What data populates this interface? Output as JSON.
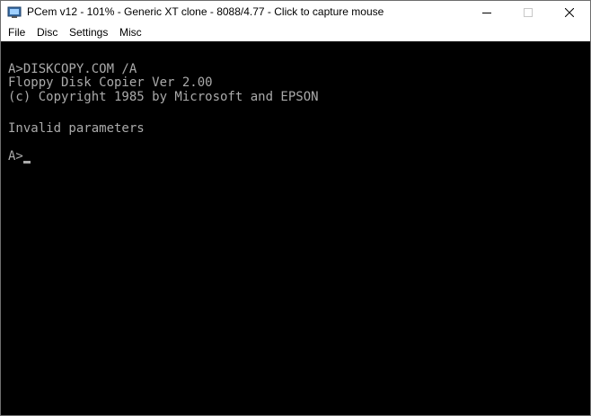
{
  "window": {
    "title": "PCem v12 - 101% - Generic XT clone - 8088/4.77 - Click to capture mouse",
    "icons": {
      "app": "pcem-app-icon",
      "minimize": "minimize-icon",
      "maximize": "maximize-icon",
      "close": "close-icon"
    },
    "colors": {
      "titlebar_bg": "#ffffff",
      "screen_bg": "#000000",
      "screen_text": "#aaaaaa"
    }
  },
  "menu": {
    "items": [
      {
        "label": "File"
      },
      {
        "label": "Disc"
      },
      {
        "label": "Settings"
      },
      {
        "label": "Misc"
      }
    ]
  },
  "screen": {
    "lines": [
      "A>DISKCOPY.COM /A",
      "Floppy Disk Copier Ver 2.00",
      "(c) Copyright 1985 by Microsoft and EPSON",
      "Invalid parameters",
      "A>"
    ]
  }
}
